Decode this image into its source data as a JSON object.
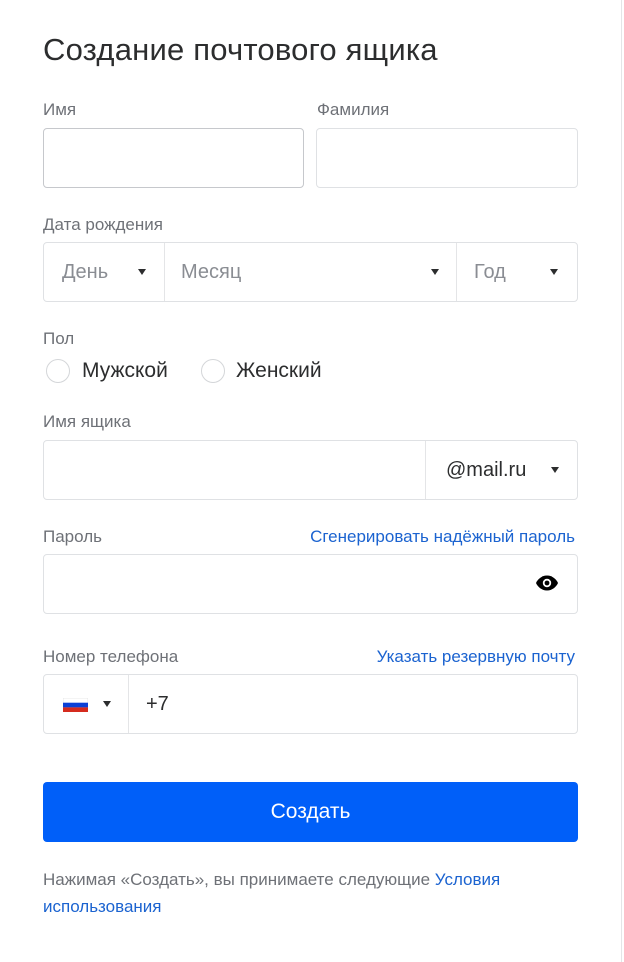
{
  "title": "Создание почтового ящика",
  "first_name": {
    "label": "Имя",
    "value": ""
  },
  "last_name": {
    "label": "Фамилия",
    "value": ""
  },
  "birth_date": {
    "label": "Дата рождения",
    "day": "День",
    "month": "Месяц",
    "year": "Год"
  },
  "gender": {
    "label": "Пол",
    "options": [
      "Мужской",
      "Женский"
    ]
  },
  "mailbox": {
    "label": "Имя ящика",
    "value": "",
    "domain": "@mail.ru"
  },
  "password": {
    "label": "Пароль",
    "generate_link": "Сгенерировать надёжный пароль",
    "icon": "eye-icon"
  },
  "phone": {
    "label": "Номер телефона",
    "backup_link": "Указать резервную почту",
    "country_flag": "russia-flag-icon",
    "prefix": "+7"
  },
  "submit_label": "Создать",
  "terms": {
    "text": "Нажимая «Создать», вы принимаете следующие ",
    "link": "Условия использования"
  },
  "colors": {
    "accent": "#005ff9",
    "link": "#1b63d0"
  }
}
